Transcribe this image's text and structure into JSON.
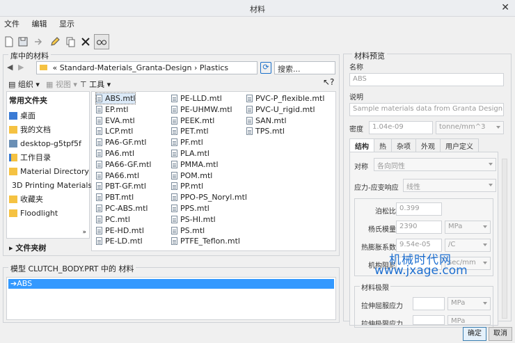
{
  "window": {
    "title": "材料"
  },
  "menu": [
    "文件",
    "编辑",
    "显示"
  ],
  "library": {
    "title": "库中的材料",
    "path": [
      "«",
      "Standard-Materials_Granta-Design",
      "›",
      "Plastics"
    ],
    "search_placeholder": "搜索...",
    "organize": "组织",
    "views": "视图",
    "tools": "工具"
  },
  "sidebar": {
    "header": "常用文件夹",
    "items": [
      "桌面",
      "我的文档",
      "desktop-g5tpf5f",
      "工作目录",
      "Material Directory",
      "3D Printing Materials",
      "收藏夹",
      "Floodlight"
    ],
    "tree": "文件夹树"
  },
  "files": {
    "col1": [
      "ABS.mtl",
      "EP.mtl",
      "EVA.mtl",
      "LCP.mtl",
      "PA6-GF.mtl",
      "PA6.mtl",
      "PA66-GF.mtl",
      "PA66.mtl",
      "PBT-GF.mtl",
      "PBT.mtl",
      "PC-ABS.mtl",
      "PC.mtl",
      "PE-HD.mtl",
      "PE-LD.mtl"
    ],
    "col2": [
      "PE-LLD.mtl",
      "PE-UHMW.mtl",
      "PEEK.mtl",
      "PET.mtl",
      "PF.mtl",
      "PLA.mtl",
      "PMMA.mtl",
      "POM.mtl",
      "PP.mtl",
      "PPO-PS_Noryl.mtl",
      "PPS.mtl",
      "PS-HI.mtl",
      "PS.mtl",
      "PTFE_Teflon.mtl"
    ],
    "col3": [
      "PVC-P_flexible.mtl",
      "PVC-U_rigid.mtl",
      "SAN.mtl",
      "TPS.mtl"
    ]
  },
  "model": {
    "title": "模型 CLUTCH_BODY.PRT 中的 材料",
    "items": [
      "ABS"
    ]
  },
  "preview": {
    "title": "材料预览",
    "name_label": "名称",
    "name_value": "ABS",
    "desc_label": "说明",
    "desc_value": "Sample materials data from Granta Design",
    "density_label": "密度",
    "density_value": "1.04e-09",
    "density_unit": "tonne/mm^3",
    "tabs": [
      "结构",
      "热",
      "杂项",
      "外观",
      "用户定义"
    ],
    "symmetry_label": "对称",
    "symmetry_value": "各向同性",
    "stress_label": "应力-应变响应",
    "stress_value": "线性",
    "poisson_label": "泊松比",
    "poisson_value": "0.399",
    "young_label": "杨氏模量",
    "young_value": "2390",
    "young_unit": "MPa",
    "thermal_label": "热膨胀系数",
    "thermal_value": "9.54e-05",
    "thermal_unit": "/C",
    "damping_label": "机构阻尼",
    "damping_unit": "sec/mm",
    "limits_title": "材料极限",
    "tensile_yield_label": "拉伸屈服应力",
    "tensile_yield_unit": "MPa",
    "tensile_ult_label": "拉伸极限应力",
    "tensile_ult_unit": "MPa"
  },
  "buttons": {
    "ok": "确定",
    "cancel": "取消"
  },
  "watermark": {
    "line1": "机械时代网",
    "line2": "www.jxage.com"
  }
}
